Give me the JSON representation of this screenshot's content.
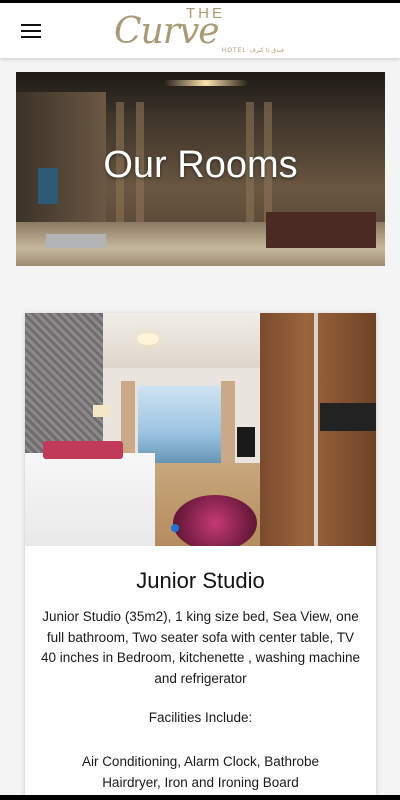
{
  "header": {
    "logo": {
      "the": "THE",
      "brand": "Curve",
      "sub": "HOTEL فندق ذا كيرف"
    }
  },
  "hero": {
    "title": "Our Rooms"
  },
  "room": {
    "title": "Junior Studio",
    "description": "Junior Studio (35m2), 1 king size bed, Sea View, one full bathroom, Two seater sofa with center table, TV 40 inches in Bedroom, kitchenette , washing machine and refrigerator",
    "facilities_label": "Facilities Include:",
    "facilities_line1": "Air Conditioning, Alarm Clock, Bathrobe",
    "facilities_line2": "Hairdryer, Iron and Ironing Board",
    "carousel_index": 1
  },
  "colors": {
    "logo_gold": "#a89a74",
    "carousel_dot": "#1e73d8"
  }
}
